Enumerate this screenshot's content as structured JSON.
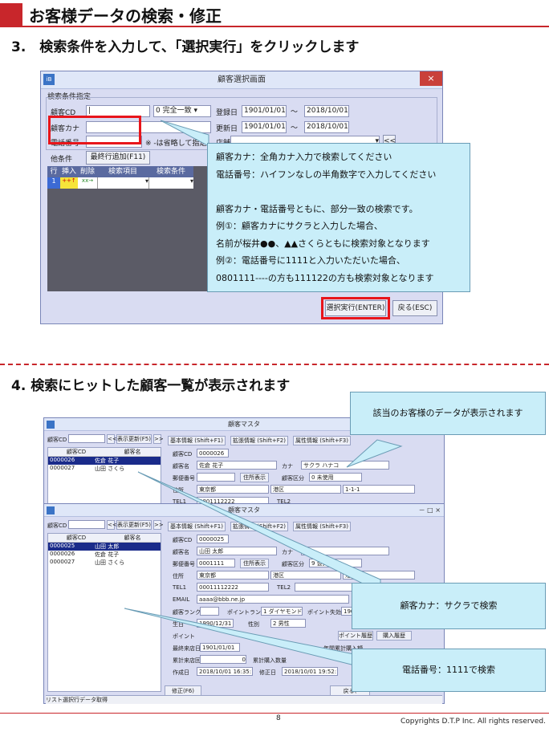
{
  "header": {
    "title": "お客様データの検索・修正"
  },
  "step3": {
    "title": "3.　検索条件を入力して、「選択実行」をクリックします"
  },
  "step4": {
    "title": "4. 検索にヒットした顧客一覧が表示されます"
  },
  "search_window": {
    "title": "顧客選択画面",
    "close": "×",
    "icon": "iB",
    "group_label": "検索条件指定",
    "cd_label": "顧客CD",
    "cd_value": "|",
    "match_select": "0 完全一致",
    "reg_date_label": "登録日",
    "reg_date_from": "1901/01/01",
    "tilde": "～",
    "reg_date_to": "2018/10/01",
    "kana_label": "顧客カナ",
    "upd_date_label": "更新日",
    "upd_date_from": "1901/01/01",
    "upd_date_to": "2018/10/01",
    "tel_label": "電話番号",
    "hint": "※ -は省略して指定",
    "shop_label": "店舗",
    "other_label": "他条件",
    "add_row_button": "最終行追加(F11)",
    "grid_headers": [
      "行",
      "挿入",
      "削除",
      "検索項目",
      "検索条件"
    ],
    "grid_row": {
      "no": "1",
      "ins": "++↑",
      "del": "xx→"
    },
    "prev_button": "<<",
    "exec_button": "選択実行(ENTER)",
    "back_button": "戻る(ESC)"
  },
  "callout_main": {
    "lines": [
      "顧客カナ：全角カナ入力で検索してください",
      "電話番号：ハイフンなしの半角数字で入力してください",
      "",
      "顧客カナ・電話番号ともに、部分一致の検索です。",
      "例①：顧客カナにサクラと入力した場合、",
      "名前が桜井●●、▲▲さくらともに検索対象となります",
      "例②：電話番号に1111と入力いただいた場合、",
      "0801111----の方も111122の方も検索対象となります"
    ]
  },
  "master_back": {
    "title": "顧客マスタ",
    "cd_label": "顧客CD",
    "prev": "<<",
    "refresh": "表示更新(F5)",
    "next": ">>",
    "tabs": [
      "基本情報 (Shift+F1)",
      "拡張情報 (Shift+F2)",
      "属性情報 (Shift+F3)"
    ],
    "list_headers": [
      "顧客CD",
      "顧客名"
    ],
    "rows": [
      [
        "0000026",
        "佐倉 花子"
      ],
      [
        "0000027",
        "山田 さくら"
      ]
    ],
    "cd_field_label": "顧客CD",
    "cd_field_value": "0000026",
    "name_label": "顧客名",
    "name_value": "佐倉 花子",
    "kana_label": "カナ",
    "kana_value": "サクラ ハナコ",
    "zip_label": "郵便番号",
    "addr_button": "住所表示",
    "kubun_label": "顧客区分",
    "kubun_value": "0 未使用",
    "addr_label": "住所",
    "pref": "東京都",
    "city": "港区",
    "street": "1-1-1",
    "tel1_label": "TEL1",
    "tel1_value": "0801112222",
    "tel2_label": "TEL2"
  },
  "master_front": {
    "title": "顧客マスタ",
    "controls": "－ □ ×",
    "cd_label": "顧客CD",
    "prev": "<<",
    "refresh": "表示更新(F5)",
    "next": ">>",
    "tabs": [
      "基本情報 (Shift+F1)",
      "拡張情報 (Shift+F2)",
      "属性情報 (Shift+F3)"
    ],
    "list_headers": [
      "顧客CD",
      "顧客名"
    ],
    "rows": [
      [
        "0000025",
        "山田 太郎"
      ],
      [
        "0000026",
        "佐倉 花子"
      ],
      [
        "0000027",
        "山田 さくら"
      ]
    ],
    "cd_field_label": "顧客CD",
    "cd_field_value": "0000025",
    "name_label": "顧客名",
    "name_value": "山田 太郎",
    "kana_label": "カナ",
    "zip_label": "郵便番号",
    "zip_value": "0001111",
    "addr_button": "住所表示",
    "kubun_label": "顧客区分",
    "kubun_value": "9 会員情報",
    "addr_label": "住所",
    "pref": "東京都",
    "city": "港区",
    "street": "港区1-1",
    "tel1_label": "TEL1",
    "tel1_value": "00011112222",
    "tel2_label": "TEL2",
    "email_label": "EMAIL",
    "email_value": "aaaa@bbb.ne.jp",
    "rank_label": "顧客ランク",
    "point_rank_label": "ポイントランク",
    "point_rank_value": "1 ダイヤモンド",
    "point_expire_label": "ポイント失効日",
    "point_expire_value": "190",
    "birth_label": "生日",
    "birth_value": "1990/12/31",
    "sex_label": "性別",
    "sex_value": "2 男性",
    "point_label": "ポイント",
    "point_history_button": "ポイント履歴",
    "purchase_history_button": "購入履歴",
    "last_visit_label": "最終来店日",
    "last_visit_value": "1901/01/01",
    "annual_purchase_label": "年間累計購入額",
    "total_visit_label": "累計来店回数",
    "total_visit_value": "0",
    "total_qty_label": "累計購入数量",
    "created_label": "作成日",
    "created_value": "2018/10/01 16:35:10",
    "modified_label": "修正日",
    "modified_value": "2018/10/01 19:52:18",
    "edit_button": "修正(F6)",
    "back_button": "戻る(",
    "status": "リスト選択行データ取得"
  },
  "callout_display": {
    "text": "該当のお客様のデータが表示されます"
  },
  "callout_kana": {
    "text": "顧客カナ：サクラで検索"
  },
  "callout_tel": {
    "text": "電話番号：1111で検索"
  },
  "footer": {
    "page": "8",
    "copyright": "Copyrights  D.T.P Inc. All rights reserved."
  }
}
